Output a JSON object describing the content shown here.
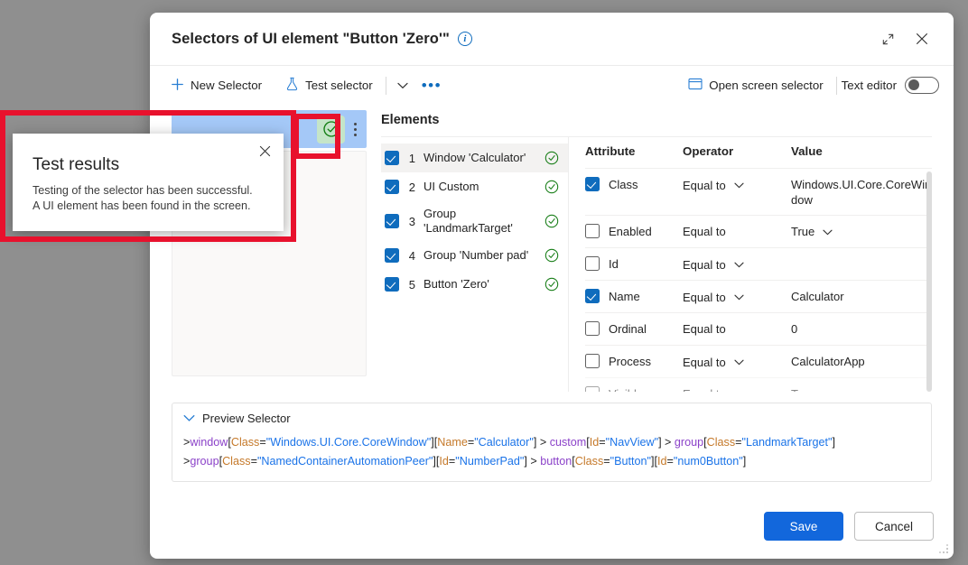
{
  "dialog": {
    "title": "Selectors of UI element \"Button 'Zero'\"",
    "info_icon": "info-icon",
    "expand_icon": "expand-icon",
    "close_icon": "close-icon"
  },
  "toolbar": {
    "new_selector": "New Selector",
    "new_selector_icon": "plus-icon",
    "test_selector": "Test selector",
    "test_selector_icon": "flask-icon",
    "chevron_icon": "chevron-down-icon",
    "overflow_icon": "ellipsis-icon",
    "open_screen_selector": "Open screen selector",
    "open_screen_selector_icon": "screen-icon",
    "text_editor": "Text editor",
    "text_editor_state": "off"
  },
  "left_panel": {
    "test_ok_icon": "check-circle-icon",
    "more_icon": "vertical-ellipsis-icon"
  },
  "elements": {
    "title": "Elements",
    "items": [
      {
        "index": "1",
        "label": "Window 'Calculator'",
        "checked": true,
        "status": "ok",
        "selected": true
      },
      {
        "index": "2",
        "label": "UI Custom",
        "checked": true,
        "status": "ok",
        "selected": false
      },
      {
        "index": "3",
        "label": "Group 'LandmarkTarget'",
        "checked": true,
        "status": "ok",
        "selected": false
      },
      {
        "index": "4",
        "label": "Group 'Number pad'",
        "checked": true,
        "status": "ok",
        "selected": false
      },
      {
        "index": "5",
        "label": "Button 'Zero'",
        "checked": true,
        "status": "ok",
        "selected": false
      }
    ]
  },
  "attributes": {
    "headers": {
      "attribute": "Attribute",
      "operator": "Operator",
      "value": "Value"
    },
    "rows": [
      {
        "name": "Class",
        "checked": true,
        "operator": "Equal to",
        "op_dropdown": true,
        "value": "Windows.UI.Core.CoreWindow",
        "val_dropdown": false
      },
      {
        "name": "Enabled",
        "checked": false,
        "operator": "Equal to",
        "op_dropdown": false,
        "value": "True",
        "val_dropdown": true
      },
      {
        "name": "Id",
        "checked": false,
        "operator": "Equal to",
        "op_dropdown": true,
        "value": "",
        "val_dropdown": false
      },
      {
        "name": "Name",
        "checked": false,
        "operator": "Equal to",
        "op_dropdown": true,
        "value": "Calculator",
        "val_dropdown": false,
        "checked_override": true
      },
      {
        "name": "Ordinal",
        "checked": false,
        "operator": "Equal to",
        "op_dropdown": false,
        "value": "0",
        "val_dropdown": false
      },
      {
        "name": "Process",
        "checked": false,
        "operator": "Equal to",
        "op_dropdown": true,
        "value": "CalculatorApp",
        "val_dropdown": false
      },
      {
        "name": "Visible",
        "checked": false,
        "operator": "Equal to",
        "op_dropdown": false,
        "value": "True",
        "val_dropdown": true
      }
    ]
  },
  "preview": {
    "header": "Preview Selector",
    "chevron_icon": "chevron-down-icon",
    "lines": [
      [
        {
          "t": "gt",
          "s": ">"
        },
        {
          "t": "el",
          "s": "window"
        },
        {
          "t": "br",
          "s": "["
        },
        {
          "t": "attr",
          "s": "Class"
        },
        {
          "t": "br",
          "s": "="
        },
        {
          "t": "val",
          "s": "\"Windows.UI.Core.CoreWindow\""
        },
        {
          "t": "br",
          "s": "]"
        },
        {
          "t": "br",
          "s": "["
        },
        {
          "t": "attr",
          "s": "Name"
        },
        {
          "t": "br",
          "s": "="
        },
        {
          "t": "val",
          "s": "\"Calculator\""
        },
        {
          "t": "br",
          "s": "]"
        },
        {
          "t": "gt",
          "s": " > "
        },
        {
          "t": "el",
          "s": "custom"
        },
        {
          "t": "br",
          "s": "["
        },
        {
          "t": "attr",
          "s": "Id"
        },
        {
          "t": "br",
          "s": "="
        },
        {
          "t": "val",
          "s": "\"NavView\""
        },
        {
          "t": "br",
          "s": "]"
        },
        {
          "t": "gt",
          "s": " > "
        },
        {
          "t": "el",
          "s": "group"
        },
        {
          "t": "br",
          "s": "["
        },
        {
          "t": "attr",
          "s": "Class"
        },
        {
          "t": "br",
          "s": "="
        },
        {
          "t": "val",
          "s": "\"LandmarkTarget\""
        },
        {
          "t": "br",
          "s": "]"
        }
      ],
      [
        {
          "t": "gt",
          "s": ">"
        },
        {
          "t": "el",
          "s": "group"
        },
        {
          "t": "br",
          "s": "["
        },
        {
          "t": "attr",
          "s": "Class"
        },
        {
          "t": "br",
          "s": "="
        },
        {
          "t": "val",
          "s": "\"NamedContainerAutomationPeer\""
        },
        {
          "t": "br",
          "s": "]"
        },
        {
          "t": "br",
          "s": "["
        },
        {
          "t": "attr",
          "s": "Id"
        },
        {
          "t": "br",
          "s": "="
        },
        {
          "t": "val",
          "s": "\"NumberPad\""
        },
        {
          "t": "br",
          "s": "]"
        },
        {
          "t": "gt",
          "s": " > "
        },
        {
          "t": "el",
          "s": "button"
        },
        {
          "t": "br",
          "s": "["
        },
        {
          "t": "attr",
          "s": "Class"
        },
        {
          "t": "br",
          "s": "="
        },
        {
          "t": "val",
          "s": "\"Button\""
        },
        {
          "t": "br",
          "s": "]"
        },
        {
          "t": "br",
          "s": "["
        },
        {
          "t": "attr",
          "s": "Id"
        },
        {
          "t": "br",
          "s": "="
        },
        {
          "t": "val",
          "s": "\"num0Button\""
        },
        {
          "t": "br",
          "s": "]"
        }
      ]
    ]
  },
  "footer": {
    "save": "Save",
    "cancel": "Cancel"
  },
  "test_results": {
    "title": "Test results",
    "message": "Testing of the selector has been successful. A UI element has been found in the screen.",
    "close_icon": "close-icon"
  },
  "colors": {
    "accent": "#0f6cbd",
    "primary_button": "#1267dc",
    "success": "#107c10",
    "annotation": "#e8112d",
    "selected_bar": "#a4c8f7",
    "success_bg": "#c5e5c8"
  }
}
